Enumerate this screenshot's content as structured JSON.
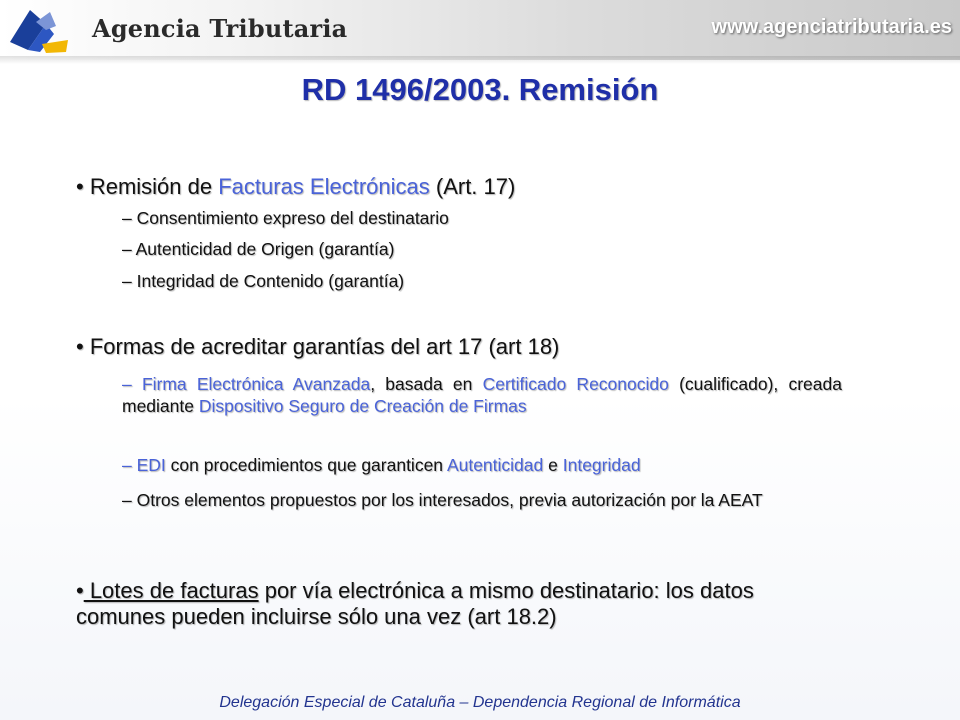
{
  "header": {
    "agency_name": "Agencia Tributaria",
    "site_url": "www.agenciatributaria.es",
    "logo_icon": "agencia-tributaria-logo-icon"
  },
  "slide": {
    "title": "RD 1496/2003. Remisión",
    "section1": {
      "bullet": "•",
      "p1": "Remisión de ",
      "h1": "Facturas Electrónicas",
      "p2": " (Art. 17)",
      "items": [
        "– Consentimiento expreso del destinatario",
        "– Autenticidad de Origen (garantía)",
        "– Integridad de Contenido (garantía)"
      ]
    },
    "section2": {
      "bullet": "•",
      "heading": "Formas de acreditar garantías del art 17 (art 18)",
      "item1": {
        "h1": "– Firma Electrónica Avanzada",
        "p1": ", basada en ",
        "h2": "Certificado Reconocido",
        "p2": " (cualificado), creada mediante ",
        "h3": "Dispositivo Seguro de Creación de Firmas"
      },
      "item2": {
        "h1": "– EDI",
        "p1": " con procedimientos que garanticen ",
        "h2": "Autenticidad",
        "p2": " e ",
        "h3": "Integridad"
      },
      "item3": "– Otros elementos propuestos por los interesados, previa autorización por la AEAT"
    },
    "section3": {
      "bullet": "•",
      "underlined": " Lotes de facturas",
      "rest": " por vía electrónica a mismo destinatario: los datos comunes pueden incluirse sólo una vez (art 18.2)"
    }
  },
  "footer": {
    "text": "Delegación Especial de Cataluña – Dependencia Regional de Informática"
  },
  "colors": {
    "title": "#1f2fa8",
    "highlight": "#4a63d8",
    "footer": "#22348f",
    "logo_blue": "#1a3f9a",
    "logo_yellow": "#f2b705"
  }
}
